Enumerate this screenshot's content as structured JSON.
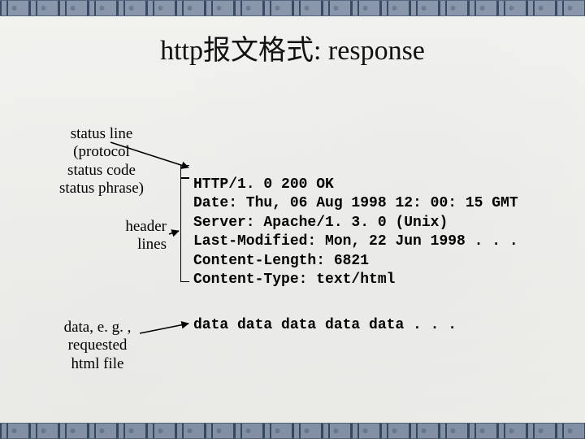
{
  "title": "http报文格式: response",
  "labels": {
    "status_line": "status line\n(protocol\nstatus code\nstatus phrase)",
    "header_lines": "header\nlines",
    "data": "data, e. g. ,\nrequested\nhtml file"
  },
  "response": {
    "status": "HTTP/1. 0 200 OK",
    "headers": [
      "Date: Thu, 06 Aug 1998 12: 00: 15 GMT",
      "Server: Apache/1. 3. 0 (Unix)",
      "Last-Modified: Mon, 22 Jun 1998 . . .",
      "Content-Length: 6821",
      "Content-Type: text/html"
    ],
    "body": "data data data data data . . ."
  }
}
